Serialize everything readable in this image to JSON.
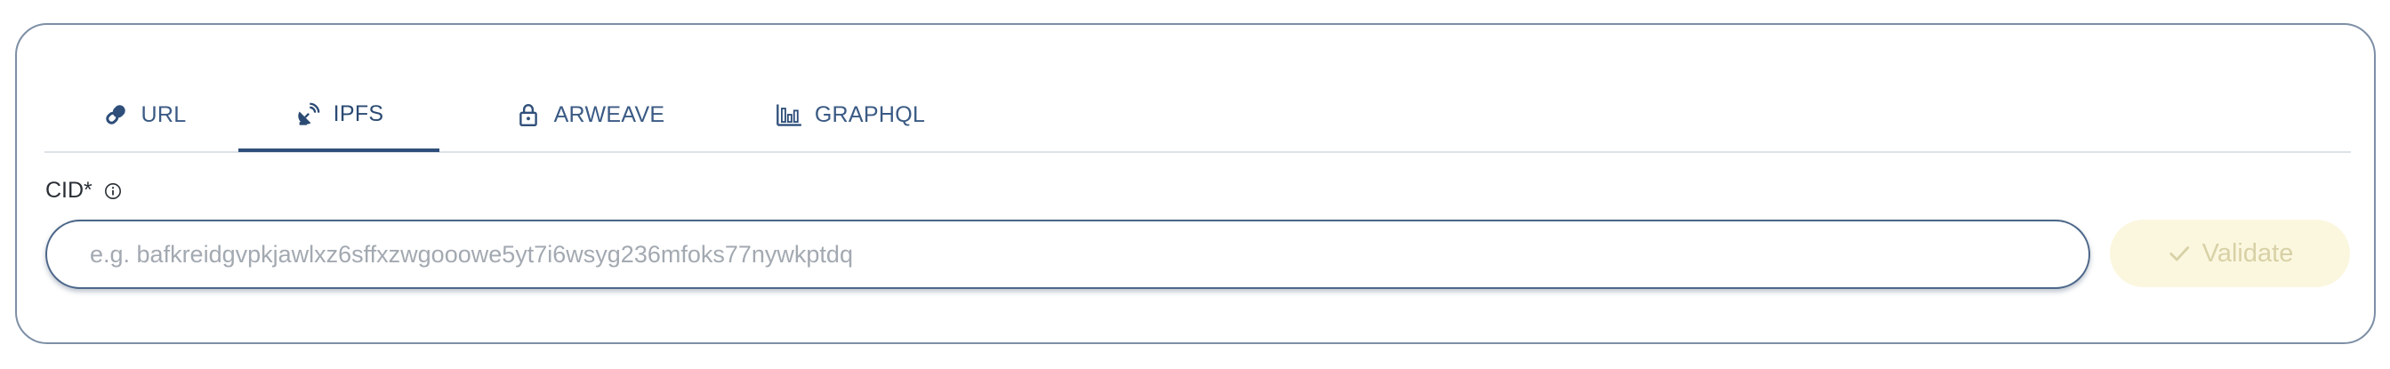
{
  "tabs": [
    {
      "label": "URL",
      "icon": "link-icon",
      "active": false
    },
    {
      "label": "IPFS",
      "icon": "satellite-dish-icon",
      "active": true
    },
    {
      "label": "ARWEAVE",
      "icon": "lock-icon",
      "active": false
    },
    {
      "label": "GRAPHQL",
      "icon": "bar-chart-icon",
      "active": false
    }
  ],
  "field": {
    "label": "CID*",
    "info_icon": "info-icon",
    "value": "",
    "placeholder": "e.g. bafkreidgvpkjawlxz6sffxzwgooowe5yt7i6wsyg236mfoks77nywkptdq"
  },
  "validate_button": {
    "label": "Validate",
    "icon": "check-icon",
    "disabled": true
  },
  "colors": {
    "tab_text": "#3a5a84",
    "active_underline": "#2f4f7a",
    "card_border": "#7d8fa6",
    "input_border": "#4c6789",
    "button_bg": "#fbf7df",
    "button_text": "#d8d1a6"
  }
}
